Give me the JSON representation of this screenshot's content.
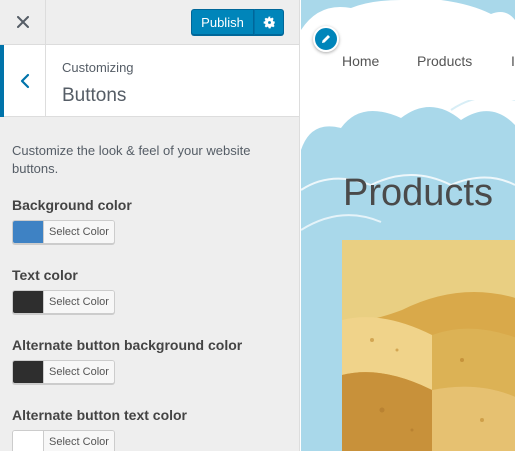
{
  "topbar": {
    "close_icon": "close-icon",
    "publish_label": "Publish",
    "settings_icon": "gear-icon"
  },
  "section": {
    "back_icon": "chevron-left-icon",
    "customizing_label": "Customizing",
    "title": "Buttons",
    "description": "Customize the look & feel of your website buttons."
  },
  "controls": [
    {
      "label": "Background color",
      "select_label": "Select Color",
      "color": "#3e82c4"
    },
    {
      "label": "Text color",
      "select_label": "Select Color",
      "color": "#2e2e2e"
    },
    {
      "label": "Alternate button background color",
      "select_label": "Select Color",
      "color": "#2e2e2e"
    },
    {
      "label": "Alternate button text color",
      "select_label": "Select Color",
      "color": "#ffffff"
    }
  ],
  "preview": {
    "edit_icon": "pencil-icon",
    "nav": [
      "Home",
      "Products",
      "I"
    ],
    "heading": "Products"
  },
  "colors": {
    "accent": "#0085ba",
    "panel_bg": "#eeeeee",
    "preview_bg": "#a9d8ea"
  }
}
